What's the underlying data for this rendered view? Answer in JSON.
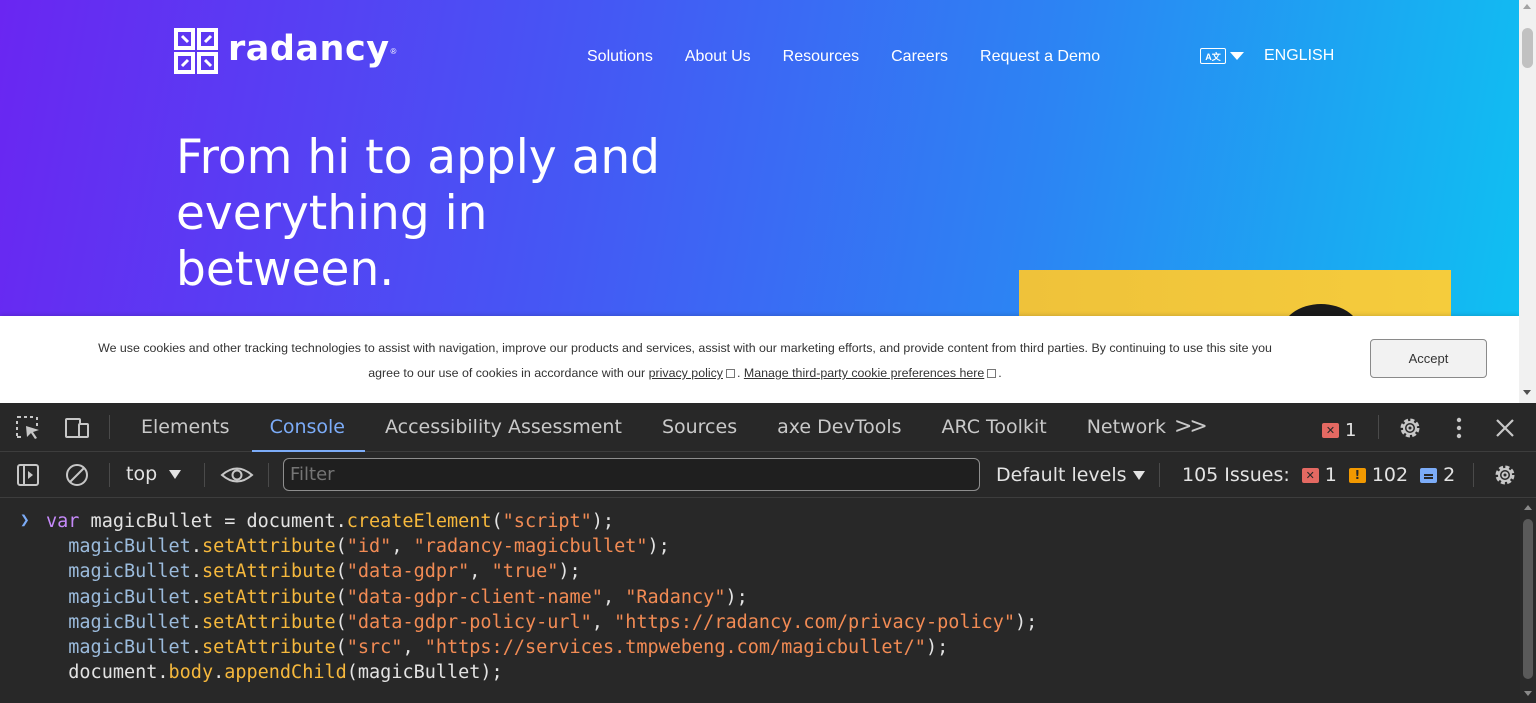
{
  "site": {
    "brand": "radancy",
    "nav": [
      "Solutions",
      "About Us",
      "Resources",
      "Careers",
      "Request a Demo"
    ],
    "language": {
      "icon": "translate-icon",
      "label": "ENGLISH"
    },
    "headline": [
      "From hi to apply and",
      "everything in",
      "between."
    ],
    "colors": {
      "gradient_start": "#6a26f2",
      "gradient_end": "#0fc0f2",
      "image_accent": "#efc23a"
    }
  },
  "cookie_banner": {
    "text_line1": "We use cookies and other tracking technologies to assist with navigation, improve our products and services, assist with our marketing efforts, and provide content from third parties. By continuing to use this site you",
    "text_line2_prefix": "agree to our use of cookies in accordance with our",
    "privacy_link": "privacy policy",
    "separator": ".",
    "manage_link": "Manage third-party cookie preferences here",
    "end": ".",
    "accept_label": "Accept"
  },
  "devtools": {
    "tabs": [
      "Elements",
      "Console",
      "Accessibility Assessment",
      "Sources",
      "axe DevTools",
      "ARC Toolkit",
      "Network"
    ],
    "active_tab": "Console",
    "more_tabs": ">>",
    "error_count": "1",
    "toolbar": {
      "context": "top",
      "filter_placeholder": "Filter",
      "levels_label": "Default levels",
      "issues_label": "105 Issues:",
      "issues_errors": "1",
      "issues_warnings": "102",
      "issues_info": "2"
    },
    "console_lines": [
      "var magicBullet = document.createElement(\"script\");",
      "  magicBullet.setAttribute(\"id\", \"radancy-magicbullet\");",
      "  magicBullet.setAttribute(\"data-gdpr\", \"true\");",
      "  magicBullet.setAttribute(\"data-gdpr-client-name\", \"Radancy\");",
      "  magicBullet.setAttribute(\"data-gdpr-policy-url\", \"https://radancy.com/privacy-policy\");",
      "  magicBullet.setAttribute(\"src\", \"https://services.tmpwebeng.com/magicbullet/\");",
      "  document.body.appendChild(magicBullet);"
    ]
  }
}
